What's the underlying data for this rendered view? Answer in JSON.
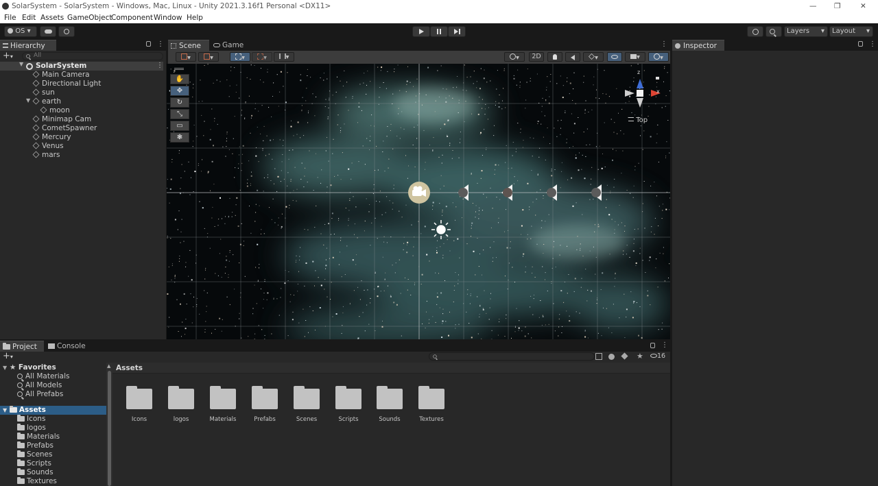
{
  "window": {
    "title": "SolarSystem - SolarSystem - Windows, Mac, Linux - Unity 2021.3.16f1 Personal <DX11>",
    "minimize": "—",
    "restore": "❐",
    "close": "✕"
  },
  "menu": [
    "File",
    "Edit",
    "Assets",
    "GameObject",
    "Component",
    "Window",
    "Help"
  ],
  "toolbar": {
    "account_label": "OS",
    "layers_label": "Layers",
    "layout_label": "Layout"
  },
  "hierarchy": {
    "tab_label": "Hierarchy",
    "search_placeholder": "All",
    "scene_name": "SolarSystem",
    "items": [
      {
        "label": "Main Camera"
      },
      {
        "label": "Directional Light"
      },
      {
        "label": "sun"
      },
      {
        "label": "earth"
      },
      {
        "label": "moon"
      },
      {
        "label": "Minimap Cam"
      },
      {
        "label": "CometSpawner"
      },
      {
        "label": "Mercury"
      },
      {
        "label": "Venus"
      },
      {
        "label": "mars"
      }
    ]
  },
  "scene": {
    "tabs": [
      {
        "label": "Scene"
      },
      {
        "label": "Game"
      }
    ],
    "mode_2d": "2D",
    "gizmo_view": "Top",
    "gizmo_axes": {
      "z": "z",
      "x": "x"
    }
  },
  "inspector": {
    "tab_label": "Inspector"
  },
  "project": {
    "tabs": [
      {
        "label": "Project"
      },
      {
        "label": "Console"
      }
    ],
    "hidden_count": "16",
    "favorites_label": "Favorites",
    "favorites": [
      {
        "label": "All Materials"
      },
      {
        "label": "All Models"
      },
      {
        "label": "All Prefabs"
      }
    ],
    "assets_label": "Assets",
    "asset_folders": [
      {
        "label": "Icons"
      },
      {
        "label": "logos"
      },
      {
        "label": "Materials"
      },
      {
        "label": "Prefabs"
      },
      {
        "label": "Scenes"
      },
      {
        "label": "Scripts"
      },
      {
        "label": "Sounds"
      },
      {
        "label": "Textures"
      }
    ],
    "breadcrumb": "Assets",
    "grid_folders": [
      {
        "label": "Icons"
      },
      {
        "label": "logos"
      },
      {
        "label": "Materials"
      },
      {
        "label": "Prefabs"
      },
      {
        "label": "Scenes"
      },
      {
        "label": "Scripts"
      },
      {
        "label": "Sounds"
      },
      {
        "label": "Textures"
      }
    ]
  },
  "colors": {
    "selection": "#2c5d87",
    "accent_blue": "#46607c",
    "panel": "#282828"
  }
}
